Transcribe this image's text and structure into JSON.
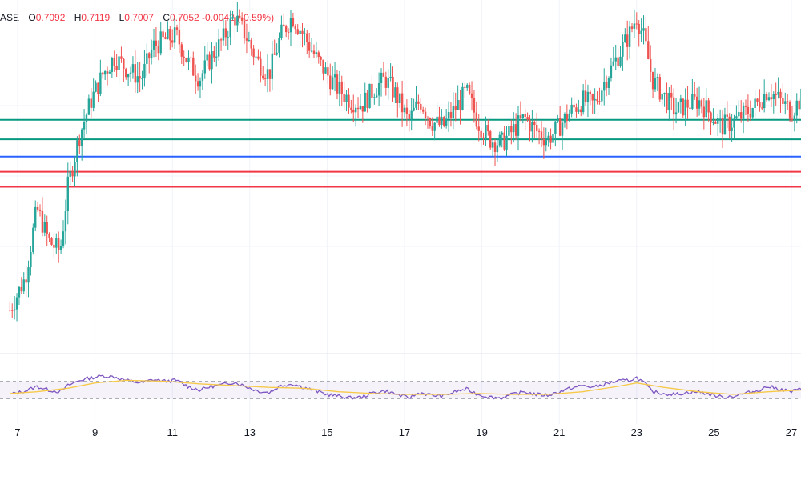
{
  "legend": {
    "symbol_tail": "ASE",
    "open_label": "O",
    "open": "0.7092",
    "high_label": "H",
    "high": "0.7119",
    "low_label": "L",
    "low": "0.7007",
    "close_label": "C",
    "close": "0.7052",
    "change": "-0.0042",
    "change_pct": "(-0.59%)"
  },
  "colors": {
    "up": "#26a69a",
    "down": "#ef5350",
    "green_line": "#089981",
    "blue_line": "#2962ff",
    "red_line": "#f23645",
    "rsi": "#7e57c2",
    "rsi_ma": "#f7c948",
    "rsi_band": "#7e57c2",
    "grid": "#f0f3fa"
  },
  "chart_data": {
    "type": "candlestick",
    "x_tick_labels": [
      "7",
      "9",
      "11",
      "13",
      "15",
      "17",
      "19",
      "21",
      "23",
      "25",
      "27"
    ],
    "price_ylim": [
      0.6965,
      0.7125
    ],
    "horizontal_levels": [
      {
        "price": 0.7071,
        "color": "green"
      },
      {
        "price": 0.7062,
        "color": "green"
      },
      {
        "price": 0.7054,
        "color": "blue"
      },
      {
        "price": 0.7047,
        "color": "red"
      },
      {
        "price": 0.704,
        "color": "red"
      }
    ],
    "close_series": [
      [
        6.8,
        0.6983
      ],
      [
        7.2,
        0.6998
      ],
      [
        7.5,
        0.703
      ],
      [
        7.8,
        0.7015
      ],
      [
        8.1,
        0.701
      ],
      [
        8.3,
        0.704
      ],
      [
        8.6,
        0.7064
      ],
      [
        8.9,
        0.708
      ],
      [
        9.2,
        0.7092
      ],
      [
        9.5,
        0.71
      ],
      [
        9.8,
        0.7095
      ],
      [
        10.2,
        0.709
      ],
      [
        10.5,
        0.7105
      ],
      [
        10.8,
        0.7108
      ],
      [
        11.1,
        0.711
      ],
      [
        11.4,
        0.7098
      ],
      [
        11.7,
        0.709
      ],
      [
        12.0,
        0.71
      ],
      [
        12.3,
        0.7108
      ],
      [
        12.6,
        0.7119
      ],
      [
        12.9,
        0.711
      ],
      [
        13.2,
        0.7098
      ],
      [
        13.5,
        0.7092
      ],
      [
        13.8,
        0.711
      ],
      [
        14.1,
        0.7119
      ],
      [
        14.4,
        0.711
      ],
      [
        14.7,
        0.71
      ],
      [
        15.0,
        0.7092
      ],
      [
        15.3,
        0.7085
      ],
      [
        15.6,
        0.708
      ],
      [
        15.9,
        0.7078
      ],
      [
        16.2,
        0.7085
      ],
      [
        16.5,
        0.709
      ],
      [
        16.8,
        0.7082
      ],
      [
        17.1,
        0.707
      ],
      [
        17.4,
        0.708
      ],
      [
        17.7,
        0.707
      ],
      [
        18.0,
        0.7068
      ],
      [
        18.3,
        0.7076
      ],
      [
        18.6,
        0.7084
      ],
      [
        18.9,
        0.707
      ],
      [
        19.2,
        0.7062
      ],
      [
        19.5,
        0.706
      ],
      [
        19.8,
        0.7066
      ],
      [
        20.1,
        0.7072
      ],
      [
        20.4,
        0.7066
      ],
      [
        20.7,
        0.7062
      ],
      [
        21.0,
        0.7068
      ],
      [
        21.3,
        0.7075
      ],
      [
        21.6,
        0.708
      ],
      [
        21.9,
        0.7078
      ],
      [
        22.2,
        0.709
      ],
      [
        22.5,
        0.71
      ],
      [
        22.8,
        0.711
      ],
      [
        23.0,
        0.7119
      ],
      [
        23.2,
        0.7108
      ],
      [
        23.4,
        0.709
      ],
      [
        23.7,
        0.7082
      ],
      [
        24.0,
        0.7075
      ],
      [
        24.3,
        0.7078
      ],
      [
        24.6,
        0.708
      ],
      [
        24.9,
        0.7074
      ],
      [
        25.2,
        0.7068
      ],
      [
        25.5,
        0.707
      ],
      [
        25.8,
        0.7074
      ],
      [
        26.1,
        0.7078
      ],
      [
        26.4,
        0.7085
      ],
      [
        26.7,
        0.708
      ],
      [
        27.0,
        0.7075
      ],
      [
        27.3,
        0.7082
      ]
    ],
    "rsi": {
      "ylim": [
        0,
        100
      ],
      "bands": [
        30,
        50,
        70
      ],
      "values": [
        [
          6.8,
          40
        ],
        [
          7.2,
          48
        ],
        [
          7.5,
          58
        ],
        [
          7.8,
          50
        ],
        [
          8.1,
          46
        ],
        [
          8.3,
          60
        ],
        [
          8.6,
          72
        ],
        [
          8.9,
          78
        ],
        [
          9.2,
          82
        ],
        [
          9.5,
          80
        ],
        [
          9.8,
          72
        ],
        [
          10.2,
          66
        ],
        [
          10.5,
          74
        ],
        [
          10.8,
          70
        ],
        [
          11.1,
          72
        ],
        [
          11.4,
          58
        ],
        [
          11.7,
          50
        ],
        [
          12.0,
          58
        ],
        [
          12.3,
          62
        ],
        [
          12.6,
          68
        ],
        [
          12.9,
          58
        ],
        [
          13.2,
          48
        ],
        [
          13.5,
          44
        ],
        [
          13.8,
          60
        ],
        [
          14.1,
          64
        ],
        [
          14.4,
          56
        ],
        [
          14.7,
          48
        ],
        [
          15.0,
          40
        ],
        [
          15.3,
          36
        ],
        [
          15.6,
          32
        ],
        [
          15.9,
          34
        ],
        [
          16.2,
          44
        ],
        [
          16.5,
          48
        ],
        [
          16.8,
          40
        ],
        [
          17.1,
          32
        ],
        [
          17.4,
          44
        ],
        [
          17.7,
          38
        ],
        [
          18.0,
          36
        ],
        [
          18.3,
          46
        ],
        [
          18.6,
          52
        ],
        [
          18.9,
          40
        ],
        [
          19.2,
          34
        ],
        [
          19.5,
          32
        ],
        [
          19.8,
          40
        ],
        [
          20.1,
          46
        ],
        [
          20.4,
          40
        ],
        [
          20.7,
          38
        ],
        [
          21.0,
          46
        ],
        [
          21.3,
          54
        ],
        [
          21.6,
          60
        ],
        [
          21.9,
          56
        ],
        [
          22.2,
          64
        ],
        [
          22.5,
          70
        ],
        [
          22.8,
          72
        ],
        [
          23.0,
          78
        ],
        [
          23.2,
          66
        ],
        [
          23.4,
          46
        ],
        [
          23.7,
          42
        ],
        [
          24.0,
          40
        ],
        [
          24.3,
          44
        ],
        [
          24.6,
          46
        ],
        [
          24.9,
          40
        ],
        [
          25.2,
          34
        ],
        [
          25.5,
          36
        ],
        [
          25.8,
          42
        ],
        [
          26.1,
          48
        ],
        [
          26.4,
          58
        ],
        [
          26.7,
          52
        ],
        [
          27.0,
          46
        ],
        [
          27.3,
          54
        ]
      ],
      "ma_values": [
        [
          6.8,
          42
        ],
        [
          7.5,
          46
        ],
        [
          8.3,
          54
        ],
        [
          9.0,
          66
        ],
        [
          9.8,
          72
        ],
        [
          10.8,
          70
        ],
        [
          11.7,
          64
        ],
        [
          12.6,
          60
        ],
        [
          13.5,
          56
        ],
        [
          14.4,
          54
        ],
        [
          15.3,
          46
        ],
        [
          16.2,
          42
        ],
        [
          17.1,
          40
        ],
        [
          18.0,
          40
        ],
        [
          18.9,
          42
        ],
        [
          19.8,
          40
        ],
        [
          20.7,
          40
        ],
        [
          21.6,
          46
        ],
        [
          22.5,
          58
        ],
        [
          23.0,
          66
        ],
        [
          23.7,
          56
        ],
        [
          24.6,
          46
        ],
        [
          25.5,
          40
        ],
        [
          26.4,
          46
        ],
        [
          27.3,
          50
        ]
      ]
    }
  }
}
